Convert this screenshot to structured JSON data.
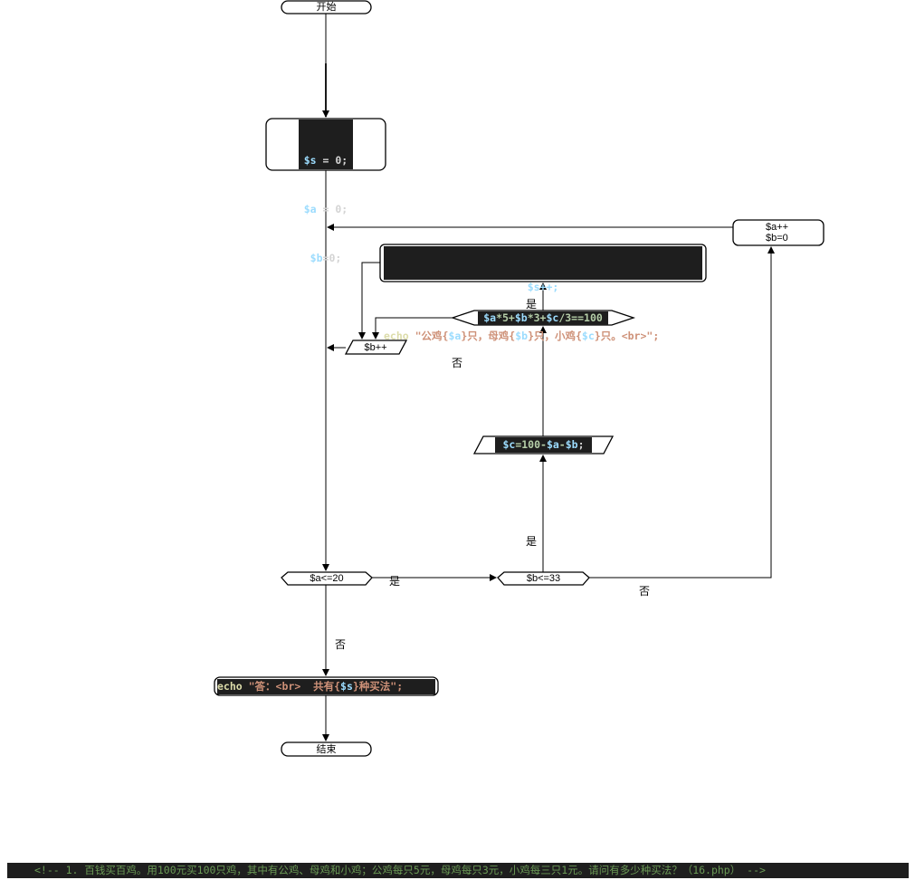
{
  "nodes": {
    "start": "开始",
    "end": "结束",
    "init": {
      "s": "$s",
      "s_rest": " = 0;",
      "a": "$a",
      "a_rest": " = 0;",
      "b": "$b",
      "b_rest": "=0;"
    },
    "a_inc": {
      "line1": "$a++",
      "line2": "$b=0"
    },
    "echo_each": {
      "s_inc": "$s++;",
      "echo_kw": "echo",
      "str1": " \"公鸡{",
      "va": "$a",
      "str2": "}只，母鸡{",
      "vb": "$b",
      "str3": "}只，小鸡{",
      "vc": "$c",
      "str4": "}只。<br>\";"
    },
    "check_sum": {
      "va": "$a",
      "t1": "*5+",
      "vb": "$b",
      "t2": "*3+",
      "vc": "$c",
      "t3": "/3==100"
    },
    "b_inc": "$b++",
    "compute_c": {
      "vc": "$c",
      "t1": "=100-",
      "va": "$a",
      "t2": "-",
      "vb": "$b",
      "t3": ";"
    },
    "cond_a": "$a<=20",
    "cond_b": "$b<=33",
    "echo_result": {
      "echo_kw": "echo",
      "str1": " \"答：<br>  共有{",
      "vs": "$s",
      "str2": "}种买法\";"
    }
  },
  "edge_labels": {
    "yes_sum": "是",
    "no_sum": "否",
    "yes_b": "是",
    "yes_a": "是",
    "no_b": "否",
    "no_a": "否"
  },
  "footer_comment": "<!-- 1. 百钱买百鸡。用100元买100只鸡，其中有公鸡、母鸡和小鸡；公鸡每只5元，母鸡每只3元，小鸡每三只1元。请问有多少种买法？（16.php） -->"
}
